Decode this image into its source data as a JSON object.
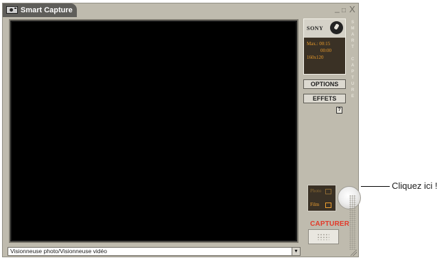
{
  "window": {
    "title": "Smart Capture",
    "controls": {
      "minimize": "_",
      "maximize": "□",
      "close": "X"
    }
  },
  "viewer": {
    "selected": "Visionneuse photo/Visionneuse vidéo"
  },
  "side_panel": {
    "brand": "SONY",
    "info": {
      "max": "Max.: 00:15",
      "elapsed": "00:00",
      "resolution": "160x120"
    },
    "options_label": "OPTIONS",
    "effects_label": "EFFETS",
    "help": "?",
    "mode_photo": "Photo",
    "mode_film": "Film",
    "capture_label": "CAPTURER",
    "vertical_brand": "SMART CAPTURE"
  },
  "callout": {
    "text": "Cliquez ici !"
  }
}
